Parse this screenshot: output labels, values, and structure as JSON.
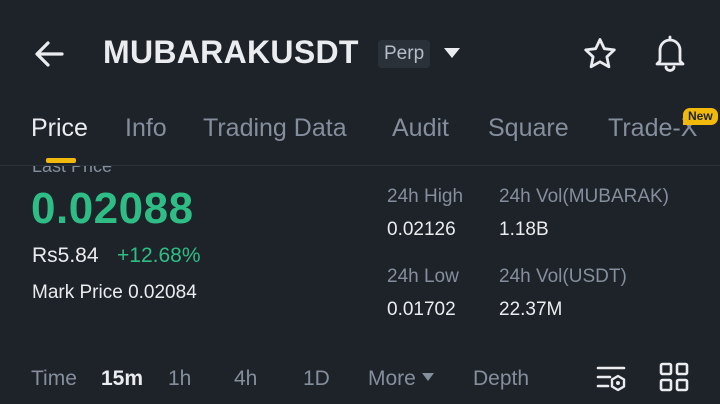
{
  "header": {
    "symbol": "MUBARAKUSDT",
    "contract_type": "Perp",
    "icons": [
      "back-arrow-icon",
      "dropdown-caret-icon",
      "favorite-star-icon",
      "notification-bell-icon"
    ]
  },
  "tabs": [
    {
      "label": "Price",
      "active": true
    },
    {
      "label": "Info"
    },
    {
      "label": "Trading Data"
    },
    {
      "label": "Audit"
    },
    {
      "label": "Square"
    },
    {
      "label": "Trade-X",
      "badge": "New"
    }
  ],
  "price": {
    "last_price_label": "Last Price",
    "last_price": "0.02088",
    "local_price": "Rs5.84",
    "change_pct": "+12.68%",
    "mark_price_label": "Mark Price",
    "mark_price": "0.02084"
  },
  "stats": {
    "high_label": "24h High",
    "high_value": "0.02126",
    "low_label": "24h Low",
    "low_value": "0.01702",
    "vol_base_label": "24h Vol(MUBARAK)",
    "vol_base_value": "1.18B",
    "vol_quote_label": "24h Vol(USDT)",
    "vol_quote_value": "22.37M"
  },
  "intervals": {
    "time_label": "Time",
    "options": [
      "15m",
      "1h",
      "4h",
      "1D"
    ],
    "selected": "15m",
    "more_label": "More",
    "depth_label": "Depth",
    "icons": [
      "indicator-settings-icon",
      "layout-grid-icon"
    ]
  },
  "colors": {
    "background": "#1e2329",
    "up_green": "#2ebd85",
    "accent_yellow": "#f0b90b",
    "muted_text": "#848e9c",
    "primary_text": "#eaecef"
  }
}
